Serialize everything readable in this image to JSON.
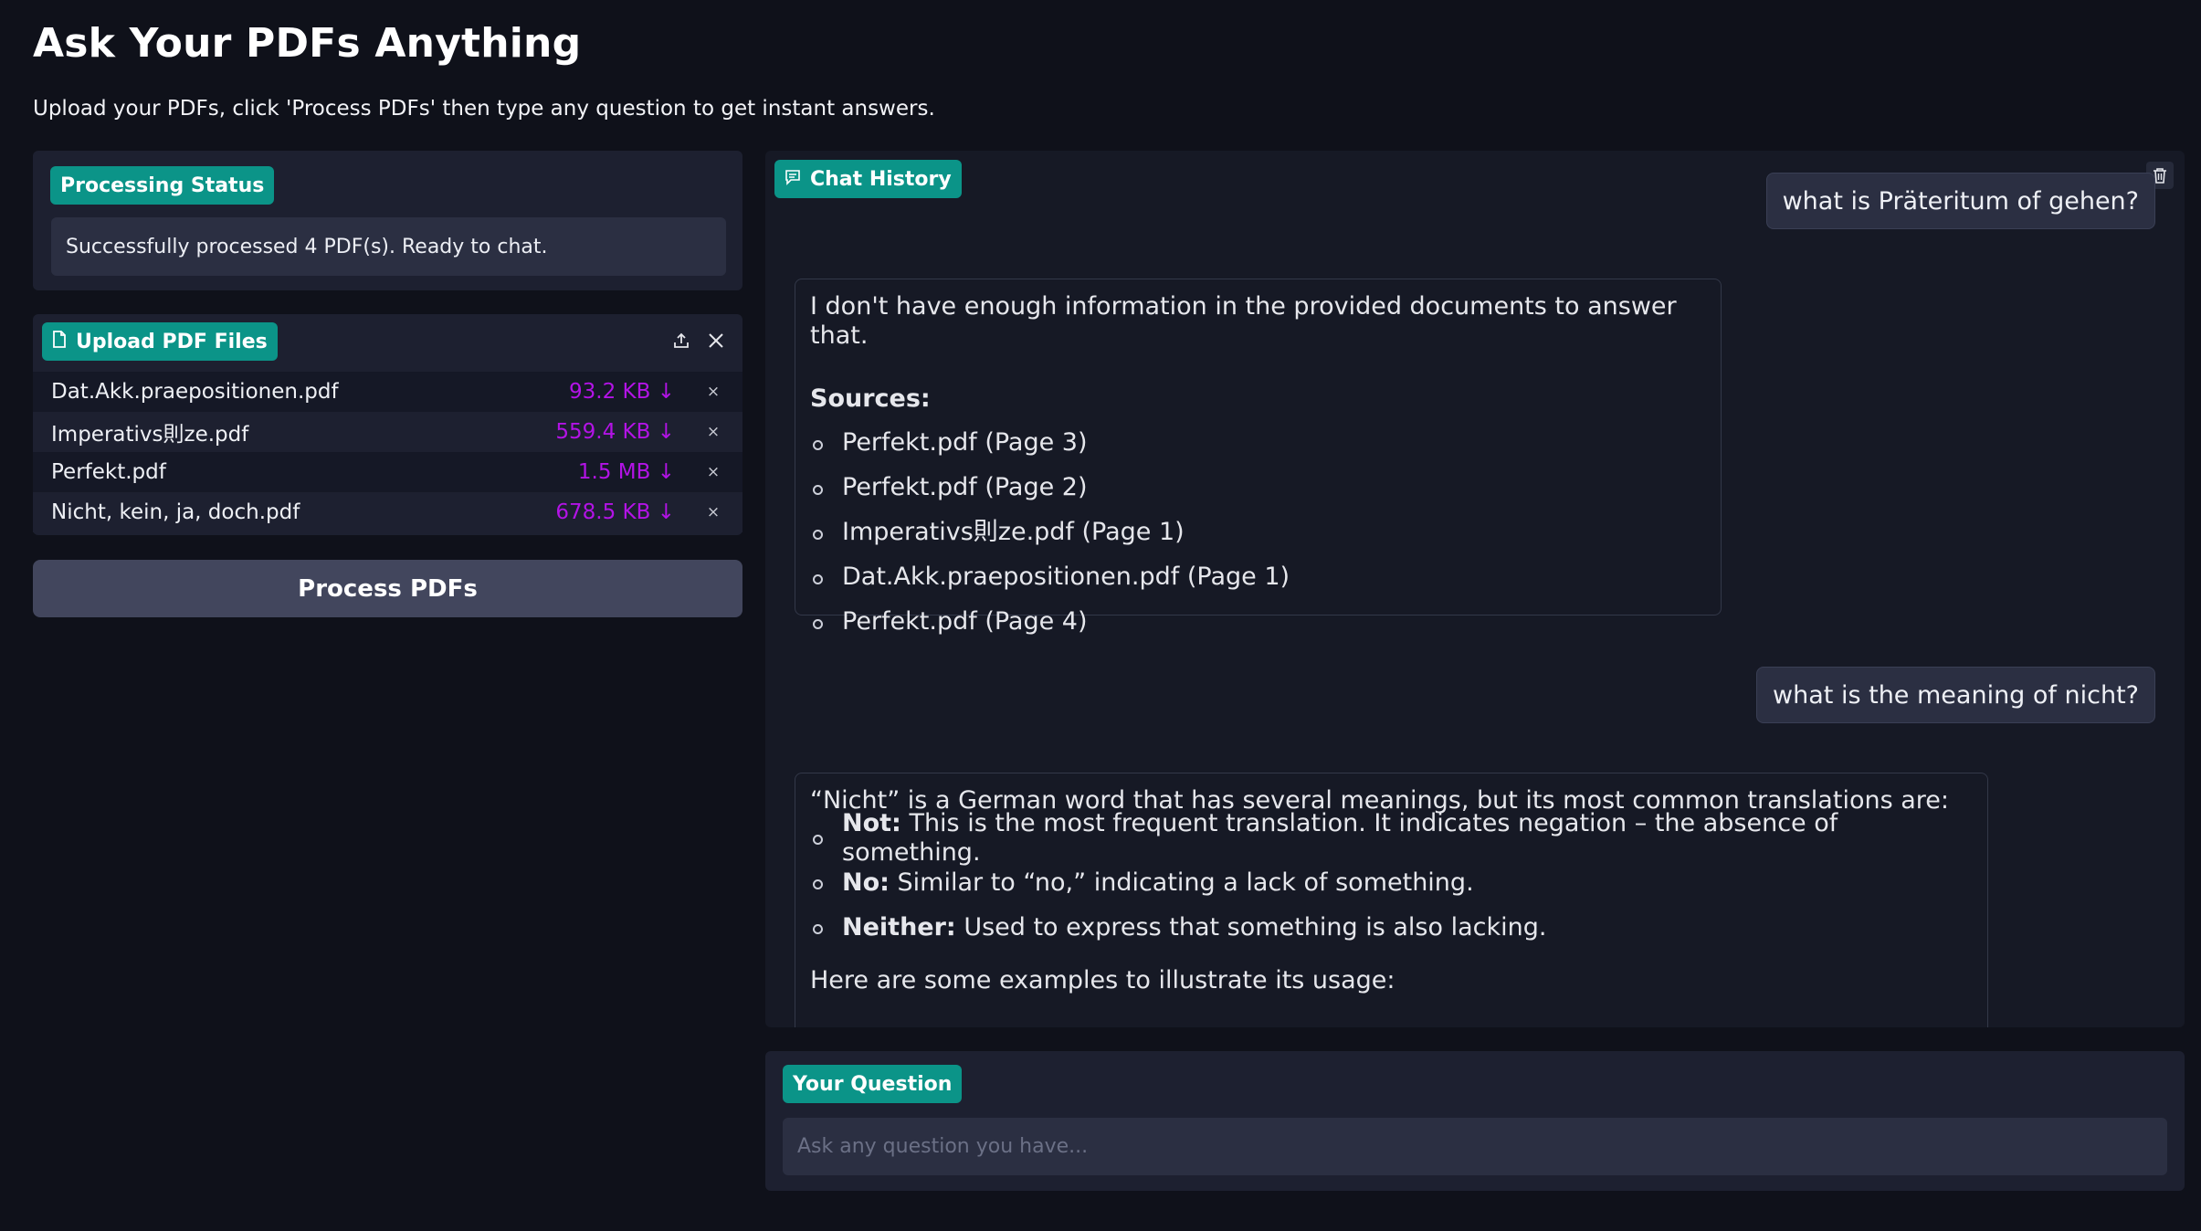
{
  "header": {
    "title": "Ask Your PDFs Anything",
    "subtitle": "Upload your PDFs, click 'Process PDFs' then type any question to get instant answers."
  },
  "status": {
    "label": "Processing Status",
    "message": "Successfully processed 4 PDF(s). Ready to chat."
  },
  "upload": {
    "label": "Upload PDF Files",
    "icon": "file-icon",
    "files": [
      {
        "name": "Dat.Akk.praepositionen.pdf",
        "size": "93.2 KB ↓"
      },
      {
        "name": "Imperativs則ze.pdf",
        "size": "559.4 KB ↓"
      },
      {
        "name": "Perfekt.pdf",
        "size": "1.5 MB ↓"
      },
      {
        "name": "Nicht, kein, ja, doch.pdf",
        "size": "678.5 KB ↓"
      }
    ],
    "remove_glyph": "×"
  },
  "process_button": "Process PDFs",
  "chat": {
    "label": "Chat History",
    "messages": [
      {
        "role": "user",
        "text": "what is Präteritum of gehen?"
      },
      {
        "role": "assistant",
        "text": "I don't have enough information in the provided documents to answer that.",
        "sources_label": "Sources:",
        "sources": [
          "Perfekt.pdf (Page 3)",
          "Perfekt.pdf (Page 2)",
          "Imperativs則ze.pdf (Page 1)",
          "Dat.Akk.praepositionen.pdf (Page 1)",
          "Perfekt.pdf (Page 4)"
        ]
      },
      {
        "role": "user",
        "text": "what is the meaning of nicht?"
      },
      {
        "role": "assistant",
        "intro": "“Nicht” is a German word that has several meanings, but its most common translations are:",
        "items": [
          {
            "term": "Not:",
            "desc": "This is the most frequent translation. It indicates negation – the absence of something."
          },
          {
            "term": "No:",
            "desc": "Similar to “no,” indicating a lack of something."
          },
          {
            "term": "Neither:",
            "desc": "Used to express that something is also lacking."
          }
        ],
        "outro": "Here are some examples to illustrate its usage:"
      }
    ]
  },
  "question": {
    "label": "Your Question",
    "placeholder": "Ask any question you have..."
  },
  "colors": {
    "accent": "#0b9488",
    "file_size": "#b313e6",
    "background": "#0f111a"
  }
}
